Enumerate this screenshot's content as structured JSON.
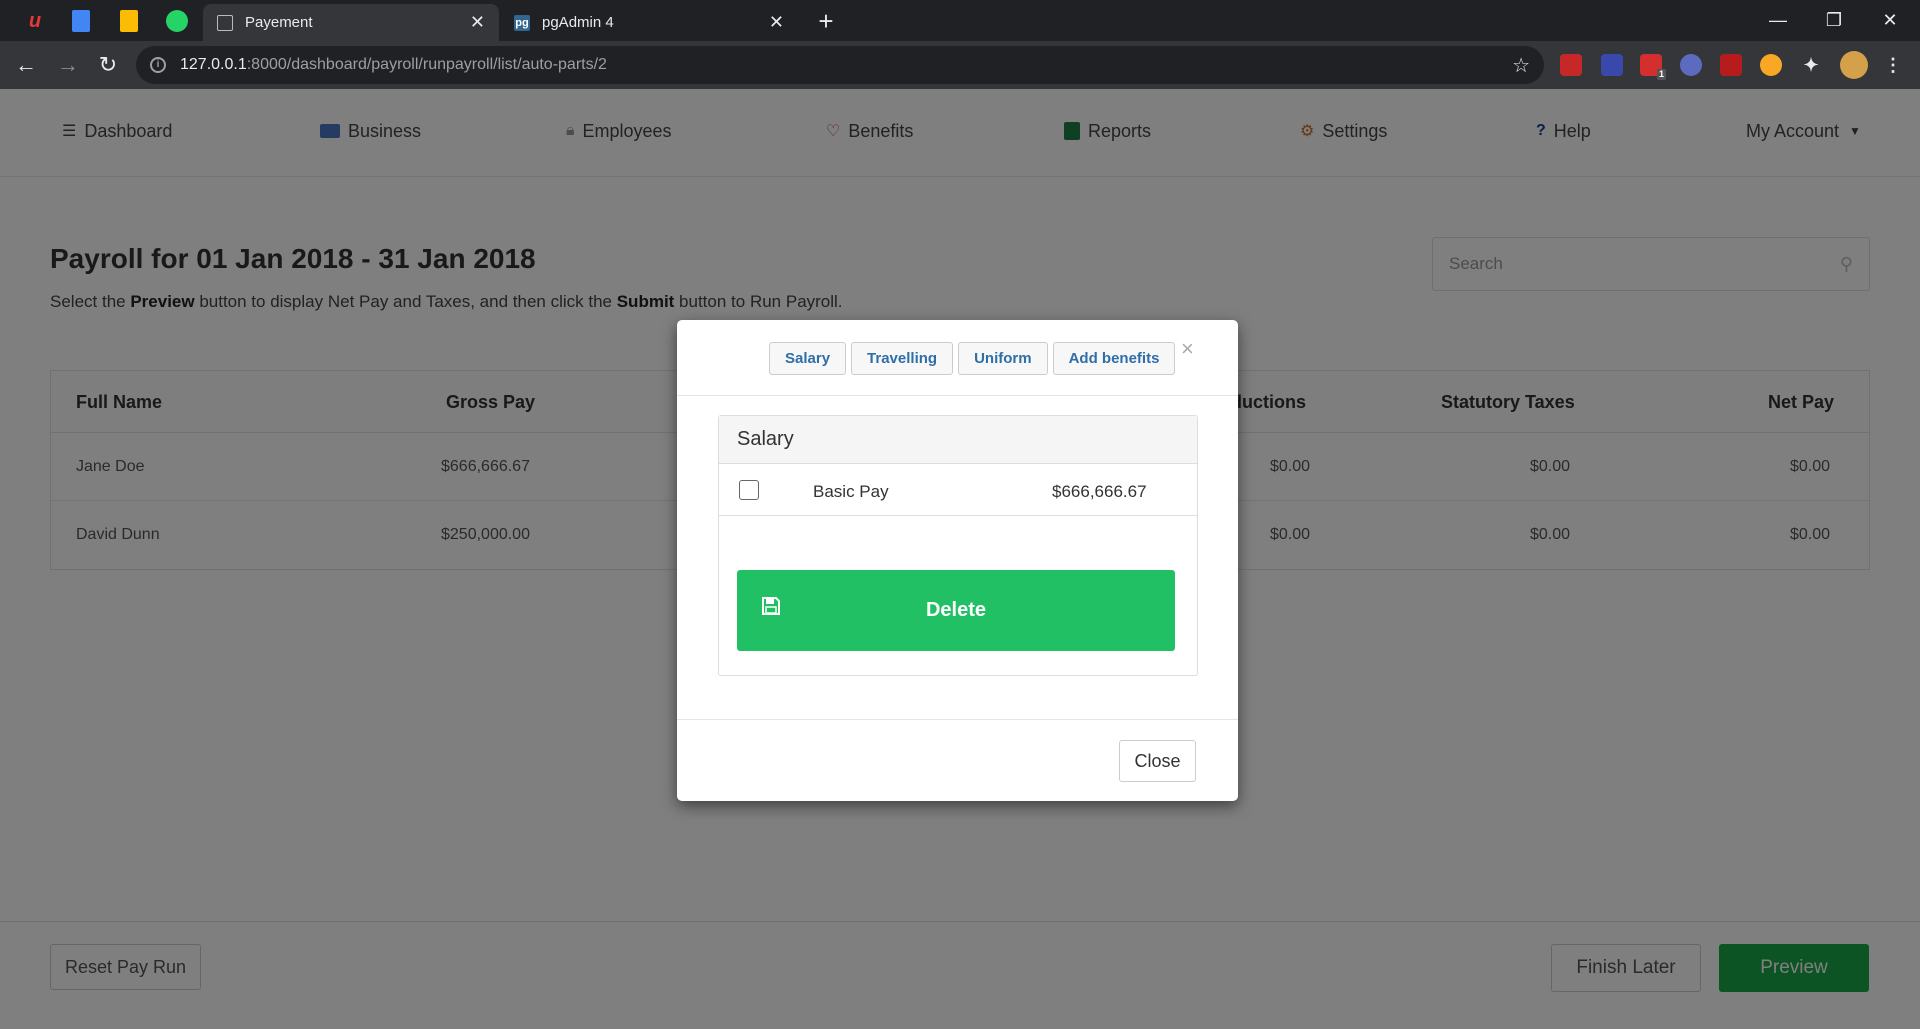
{
  "browser": {
    "tabs": [
      {
        "title": "Payement",
        "active": true
      },
      {
        "title": "pgAdmin 4",
        "active": false
      }
    ],
    "url_host": "127.0.0.1",
    "url_path": ":8000/dashboard/payroll/runpayroll/list/auto-parts/2",
    "extension_badge": "1"
  },
  "nav": {
    "items": [
      {
        "label": "Dashboard",
        "icon": "bars-icon"
      },
      {
        "label": "Business",
        "icon": "card-icon"
      },
      {
        "label": "Employees",
        "icon": "lock-icon"
      },
      {
        "label": "Benefits",
        "icon": "heart-icon"
      },
      {
        "label": "Reports",
        "icon": "reports-icon"
      },
      {
        "label": "Settings",
        "icon": "gear-icon"
      },
      {
        "label": "Help",
        "icon": "question-icon"
      },
      {
        "label": "My Account",
        "icon": "caret-down-icon"
      }
    ]
  },
  "page": {
    "title": "Payroll for 01 Jan 2018 - 31 Jan 2018",
    "sub_1": "Select the ",
    "sub_bold_1": "Preview",
    "sub_2": " button to display Net Pay and Taxes, and then click the ",
    "sub_bold_2": "Submit",
    "sub_3": " button to Run Payroll.",
    "search_placeholder": "Search"
  },
  "table": {
    "headers": {
      "full_name": "Full Name",
      "gross_pay": "Gross Pay",
      "deductions": "ductions",
      "statutory_taxes": "Statutory Taxes",
      "net_pay": "Net Pay"
    },
    "rows": [
      {
        "name": "Jane Doe",
        "gross": "$666,666.67",
        "deductions": "$0.00",
        "taxes": "$0.00",
        "net": "$0.00"
      },
      {
        "name": "David Dunn",
        "gross": "$250,000.00",
        "deductions": "$0.00",
        "taxes": "$0.00",
        "net": "$0.00"
      }
    ]
  },
  "footer": {
    "reset": "Reset Pay Run",
    "finish_later": "Finish Later",
    "preview": "Preview"
  },
  "modal": {
    "tabs": [
      "Salary",
      "Travelling",
      "Uniform",
      "Add benefits"
    ],
    "close_x": "×",
    "panel_title": "Salary",
    "row_label": "Basic Pay",
    "row_amount": "$666,666.67",
    "delete_label": "Delete",
    "close_label": "Close"
  },
  "colors": {
    "accent_green": "#21c064",
    "preview_green": "#1ba84b",
    "tab_link_blue": "#2f6fa7"
  }
}
